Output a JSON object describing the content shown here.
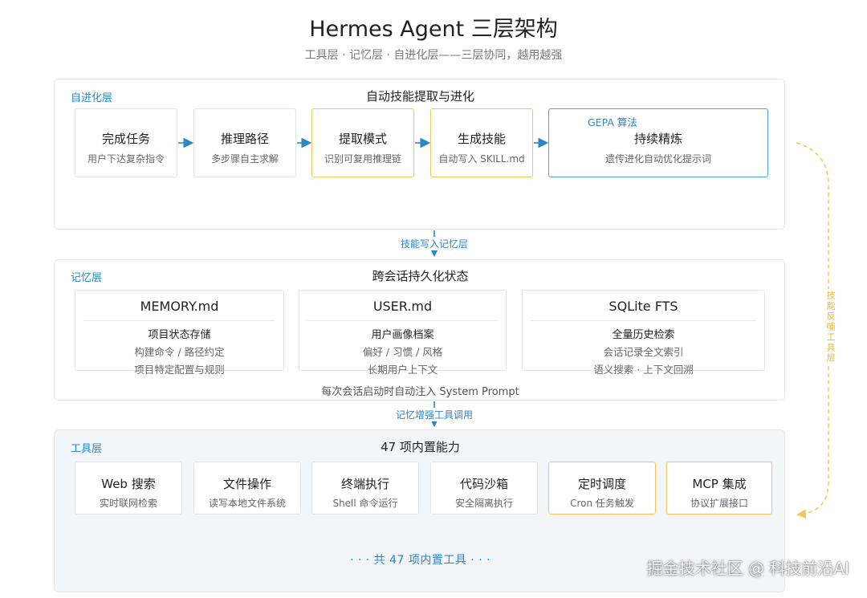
{
  "header": {
    "title": "Hermes Agent 三层架构",
    "subtitle": "工具层 · 记忆层 · 自进化层——三层协同，越用越强"
  },
  "evolution": {
    "label": "自进化层",
    "heading": "自动技能提取与进化",
    "cards": [
      {
        "title": "完成任务",
        "sub": "用户下达复杂指令"
      },
      {
        "title": "推理路径",
        "sub": "多步骤自主求解"
      },
      {
        "title": "提取模式",
        "sub": "识别可复用推理链"
      },
      {
        "title": "生成技能",
        "sub": "自动写入 SKILL.md"
      },
      {
        "title": "持续精炼",
        "sub": "遗传进化自动优化提示词",
        "tag": "GEPA 算法"
      }
    ]
  },
  "flows": {
    "skills_to_memory": "技能写入记忆层",
    "memory_to_tools": "记忆增强工具调用",
    "side": "技能反哺工具层"
  },
  "memory": {
    "label": "记忆层",
    "heading": "跨会话持久化状态",
    "cards": [
      {
        "file": "MEMORY.md",
        "title": "项目状态存储",
        "line1": "构建命令 / 路径约定",
        "line2": "项目特定配置与规则"
      },
      {
        "file": "USER.md",
        "title": "用户画像档案",
        "line1": "偏好 / 习惯 / 风格",
        "line2": "长期用户上下文"
      },
      {
        "file": "SQLite FTS",
        "title": "全量历史检索",
        "line1": "会话记录全文索引",
        "line2": "语义搜索 · 上下文回溯"
      }
    ],
    "note": "每次会话启动时自动注入 System Prompt"
  },
  "tools": {
    "label": "工具层",
    "heading": "47 项内置能力",
    "cards": [
      {
        "title": "Web 搜索",
        "sub": "实时联网检索"
      },
      {
        "title": "文件操作",
        "sub": "读写本地文件系统"
      },
      {
        "title": "终端执行",
        "sub": "Shell 命令运行"
      },
      {
        "title": "代码沙箱",
        "sub": "安全隔离执行"
      },
      {
        "title": "定时调度",
        "sub": "Cron 任务触发"
      },
      {
        "title": "MCP 集成",
        "sub": "协议扩展接口"
      }
    ],
    "footer": "· · · 共 47 项内置工具 · · ·"
  },
  "watermark": "掘金技术社区 @ 科技前沿AI",
  "colors": {
    "accent_blue": "#2a86c9",
    "highlight_gold": "#efc85b",
    "tools_bg": "#f3f6f9"
  }
}
